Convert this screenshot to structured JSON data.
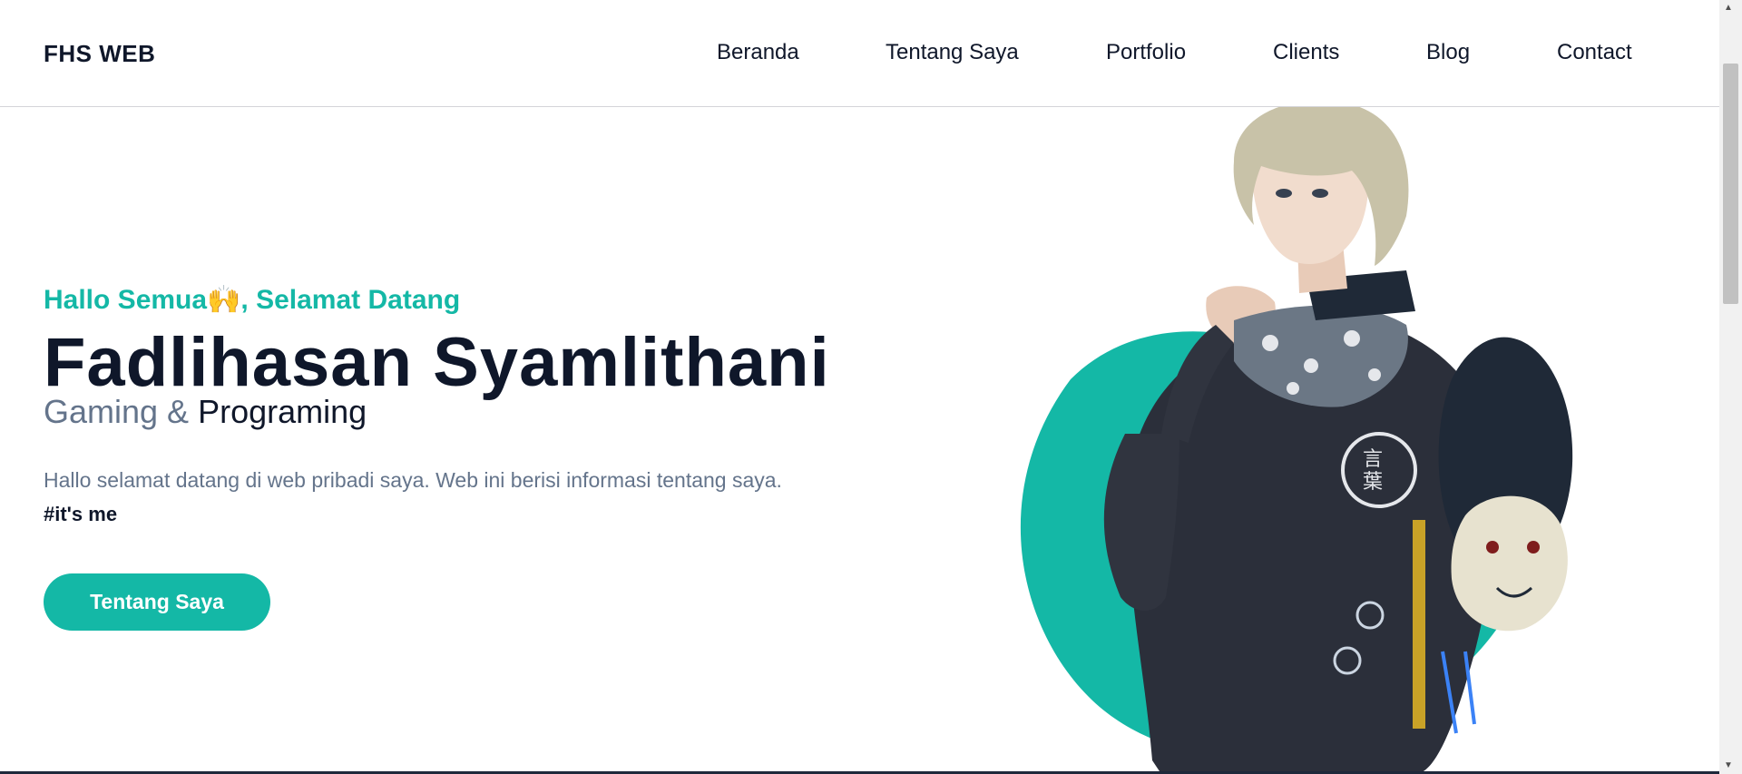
{
  "brand": "FHS WEB",
  "nav": {
    "items": [
      {
        "label": "Beranda"
      },
      {
        "label": "Tentang Saya"
      },
      {
        "label": "Portfolio"
      },
      {
        "label": "Clients"
      },
      {
        "label": "Blog"
      },
      {
        "label": "Contact"
      }
    ]
  },
  "hero": {
    "greeting": "Hallo Semua🙌, Selamat Datang",
    "name": "Fadlihasan Syamlithani",
    "role_part1": "Gaming &",
    "role_part2": "Programing",
    "description": "Hallo selamat datang di web pribadi saya. Web ini berisi informasi tentang saya.",
    "tagline": "#it's me",
    "cta_label": "Tentang Saya",
    "illustration": "anime-character-portrait"
  },
  "colors": {
    "accent": "#14b8a6",
    "text_dark": "#0f172a",
    "text_muted": "#64748b"
  }
}
